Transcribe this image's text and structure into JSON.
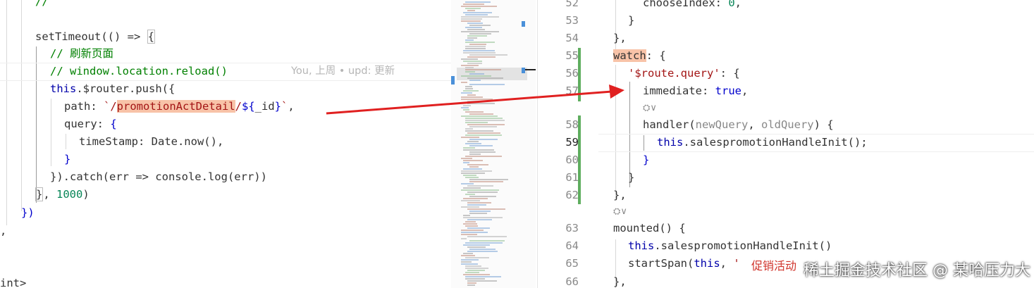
{
  "left_editor": {
    "lines": [
      {
        "text": "//"
      },
      {
        "text": "setTimeout(() => {"
      },
      {
        "text": "// 刷新页面"
      },
      {
        "text": "// window.location.reload()"
      },
      {
        "text": "this.$router.push({"
      },
      {
        "text": "path: `/promotionActDetail/${_id}`,"
      },
      {
        "text": "query: {"
      },
      {
        "text": "timeStamp: Date.now(),"
      },
      {
        "text": "}"
      },
      {
        "text": "}).catch(err => console.log(err))"
      },
      {
        "text": "}, 1000)"
      },
      {
        "text": "})"
      },
      {
        "text": ","
      },
      {
        "text": "int>"
      }
    ],
    "blame": "You, 上周 • upd: 更新"
  },
  "right_editor": {
    "lines": [
      {
        "num": "52",
        "text": "chooseIndex: 0,"
      },
      {
        "num": "53",
        "text": "}"
      },
      {
        "num": "54",
        "text": "},"
      },
      {
        "num": "55",
        "text": "watch: {"
      },
      {
        "num": "56",
        "text": "'$route.query': {"
      },
      {
        "num": "57",
        "text": "immediate: true,"
      },
      {
        "num": "58",
        "text": "handler(newQuery, oldQuery) {"
      },
      {
        "num": "59",
        "text": "this.salespromotionHandleInit();"
      },
      {
        "num": "60",
        "text": "}"
      },
      {
        "num": "61",
        "text": "}"
      },
      {
        "num": "62",
        "text": "},"
      },
      {
        "num": "63",
        "text": "mounted() {"
      },
      {
        "num": "64",
        "text": "this.salespromotionHandleInit()"
      },
      {
        "num": "65",
        "text": "startSpan(this, '促销活动"
      },
      {
        "num": "66",
        "text": "},"
      }
    ],
    "codelens": "⛭∨"
  },
  "watermark": {
    "text": "稀土掘金技术社区 @ 某哈压力大",
    "overlay": "促销活动"
  },
  "colors": {
    "highlight": "#f8c3a8",
    "arrow": "#e02020",
    "git_added": "#5fae5f"
  }
}
